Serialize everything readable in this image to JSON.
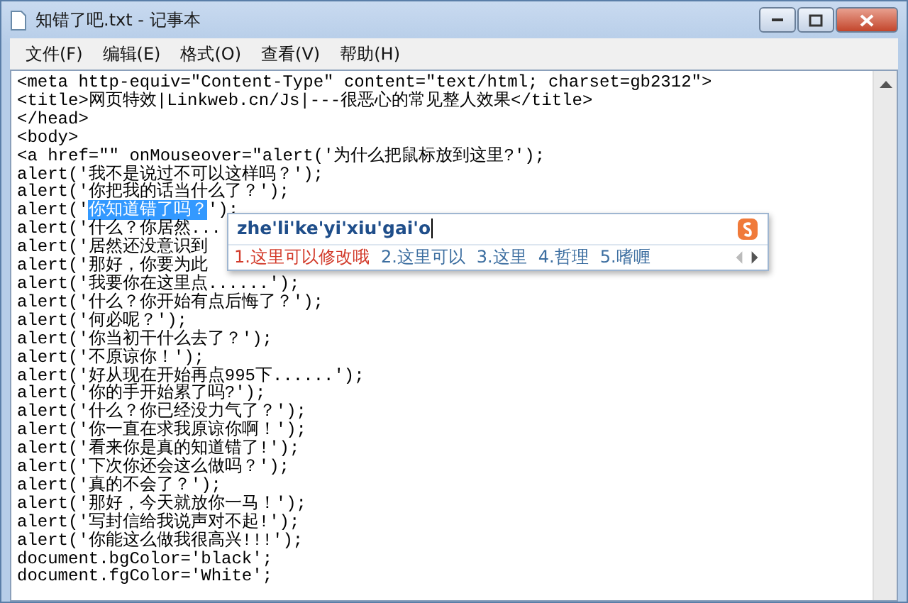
{
  "window": {
    "title": "知错了吧.txt - 记事本"
  },
  "menu": [
    "文件(F)",
    "编辑(E)",
    "格式(O)",
    "查看(V)",
    "帮助(H)"
  ],
  "lines": [
    {
      "text": "<meta http-equiv=\"Content-Type\" content=\"text/html; charset=gb2312\">"
    },
    {
      "text": "<title>网页特效|Linkweb.cn/Js|---很恶心的常见整人效果</title>"
    },
    {
      "text": "</head>"
    },
    {
      "text": "<body>"
    },
    {
      "text": "<a href=\"\" onMouseover=\"alert('为什么把鼠标放到这里?');"
    },
    {
      "text": "alert('我不是说过不可以这样吗？');"
    },
    {
      "text": "alert('你把我的话当什么了？');"
    },
    {
      "text": "alert('",
      "selection": "你知道错了吗？",
      "after": "');"
    },
    {
      "text": "alert('什么？你居然..."
    },
    {
      "text": "alert('居然还没意识到"
    },
    {
      "text": "alert('那好，你要为此"
    },
    {
      "text": "alert('我要你在这里点......');"
    },
    {
      "text": "alert('什么？你开始有点后悔了？');"
    },
    {
      "text": "alert('何必呢？');"
    },
    {
      "text": "alert('你当初干什么去了？');"
    },
    {
      "text": "alert('不原谅你！');"
    },
    {
      "text": "alert('好从现在开始再点995下......');"
    },
    {
      "text": "alert('你的手开始累了吗?');"
    },
    {
      "text": "alert('什么？你已经没力气了？');"
    },
    {
      "text": "alert('你一直在求我原谅你啊！');"
    },
    {
      "text": "alert('看来你是真的知道错了!');"
    },
    {
      "text": "alert('下次你还会这么做吗？');"
    },
    {
      "text": "alert('真的不会了？');"
    },
    {
      "text": "alert('那好，今天就放你一马！');"
    },
    {
      "text": "alert('写封信给我说声对不起!');"
    },
    {
      "text": "alert('你能这么做我很高兴!!!');"
    },
    {
      "text": "document.bgColor='black';"
    },
    {
      "text": "document.fgColor='White';"
    }
  ],
  "ime": {
    "composition": "zhe'li'ke'yi'xiu'gai'o",
    "candidates": [
      {
        "text": "1.这里可以修改哦",
        "selected": true
      },
      {
        "text": "2.这里可以",
        "selected": false
      },
      {
        "text": "3.这里",
        "selected": false
      },
      {
        "text": "4.哲理",
        "selected": false
      },
      {
        "text": "5.嗜喱",
        "selected": false
      }
    ]
  }
}
